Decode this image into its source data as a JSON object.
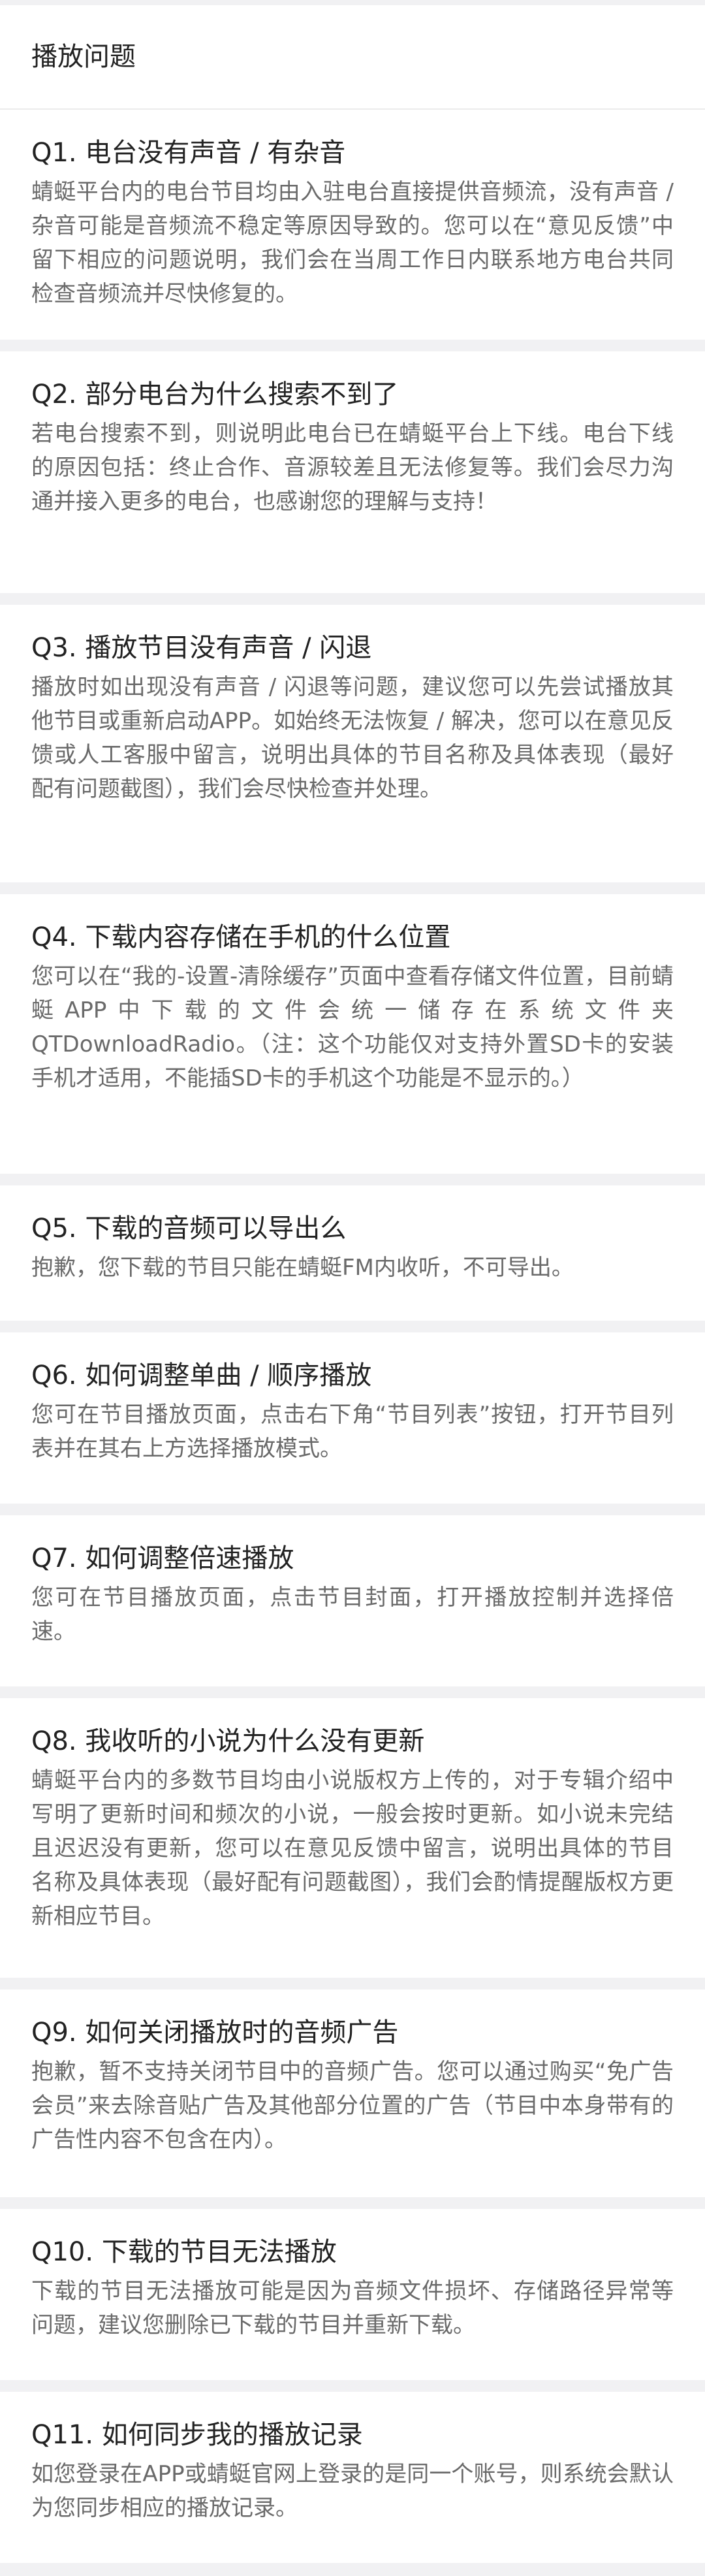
{
  "page": {
    "title": "播放问题"
  },
  "faq": [
    {
      "question": "Q1. 电台没有声音 / 有杂音",
      "answer": "蜻蜓平台内的电台节目均由入驻电台直接提供音频流，没有声音 / 杂音可能是音频流不稳定等原因导致的。您可以在“意见反馈”中留下相应的问题说明，我们会在当周工作日内联系地方电台共同检查音频流并尽快修复的。"
    },
    {
      "question": "Q2. 部分电台为什么搜索不到了",
      "answer": "若电台搜索不到，则说明此电台已在蜻蜓平台上下线。电台下线的原因包括：终止合作、音源较差且无法修复等。我们会尽力沟通并接入更多的电台，也感谢您的理解与支持！"
    },
    {
      "question": "Q3. 播放节目没有声音 / 闪退",
      "answer": "播放时如出现没有声音 / 闪退等问题，建议您可以先尝试播放其他节目或重新启动APP。如始终无法恢复 / 解决，您可以在意见反馈或人工客服中留言，说明出具体的节目名称及具体表现（最好配有问题截图），我们会尽快检查并处理。"
    },
    {
      "question": "Q4. 下载内容存储在手机的什么位置",
      "answer": "您可以在“我的-设置-清除缓存”页面中查看存储文件位置，目前蜻蜓APP中下载的文件会统一储存在系统文件夹QTDownloadRadio。（注：这个功能仅对支持外置SD卡的安装手机才适用，不能插SD卡的手机这个功能是不显示的。）"
    },
    {
      "question": "Q5. 下载的音频可以导出么",
      "answer": "抱歉，您下载的节目只能在蜻蜓FM内收听，不可导出。"
    },
    {
      "question": "Q6. 如何调整单曲 / 顺序播放",
      "answer": "您可在节目播放页面，点击右下角“节目列表”按钮，打开节目列表并在其右上方选择播放模式。"
    },
    {
      "question": "Q7. 如何调整倍速播放",
      "answer": "您可在节目播放页面，点击节目封面，打开播放控制并选择倍速。"
    },
    {
      "question": "Q8. 我收听的小说为什么没有更新",
      "answer": "蜻蜓平台内的多数节目均由小说版权方上传的，对于专辑介绍中写明了更新时间和频次的小说，一般会按时更新。如小说未完结且迟迟没有更新，您可以在意见反馈中留言，说明出具体的节目名称及具体表现（最好配有问题截图），我们会酌情提醒版权方更新相应节目。"
    },
    {
      "question": "Q9. 如何关闭播放时的音频广告",
      "answer": "抱歉，暂不支持关闭节目中的音频广告。您可以通过购买“免广告会员”来去除音贴广告及其他部分位置的广告（节目中本身带有的广告性内容不包含在内）。"
    },
    {
      "question": "Q10. 下载的节目无法播放",
      "answer": "下载的节目无法播放可能是因为音频文件损坏、存储路径异常等问题，建议您删除已下载的节目并重新下载。"
    },
    {
      "question": "Q11. 如何同步我的播放记录",
      "answer": "如您登录在APP或蜻蜓官网上登录的是同一个账号，则系统会默认为您同步相应的播放记录。"
    }
  ]
}
